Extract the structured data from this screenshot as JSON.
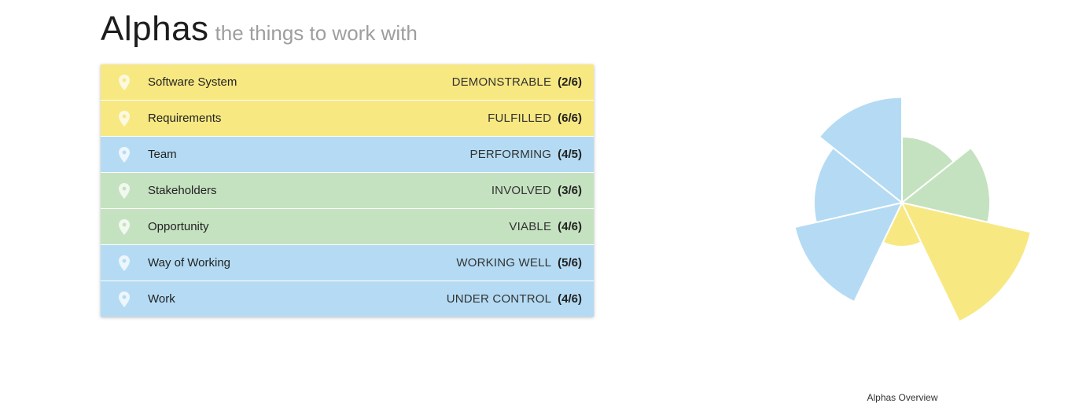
{
  "header": {
    "title": "Alphas",
    "subtitle": "the things to work with"
  },
  "colors": {
    "yellow": "#f7e882",
    "blue": "#b4dbf3",
    "green": "#c5e2c0"
  },
  "alphas": [
    {
      "name": "Software System",
      "state": "DEMONSTRABLE",
      "progress": "(2/6)",
      "color": "yellow",
      "icon": "location-pin-icon"
    },
    {
      "name": "Requirements",
      "state": "FULFILLED",
      "progress": "(6/6)",
      "color": "yellow",
      "icon": "location-pin-icon"
    },
    {
      "name": "Team",
      "state": "PERFORMING",
      "progress": "(4/5)",
      "color": "blue",
      "icon": "location-pin-icon"
    },
    {
      "name": "Stakeholders",
      "state": "INVOLVED",
      "progress": "(3/6)",
      "color": "green",
      "icon": "location-pin-icon"
    },
    {
      "name": "Opportunity",
      "state": "VIABLE",
      "progress": "(4/6)",
      "color": "green",
      "icon": "location-pin-icon"
    },
    {
      "name": "Way of Working",
      "state": "WORKING WELL",
      "progress": "(5/6)",
      "color": "blue",
      "icon": "location-pin-icon"
    },
    {
      "name": "Work",
      "state": "UNDER CONTROL",
      "progress": "(4/6)",
      "color": "blue",
      "icon": "location-pin-icon"
    }
  ],
  "chart": {
    "caption": "Alphas Overview"
  },
  "chart_data": {
    "type": "pie",
    "variant": "polar-area",
    "title": "Alphas Overview",
    "categories": [
      "Stakeholders",
      "Opportunity",
      "Requirements",
      "Software System",
      "Way of Working",
      "Work",
      "Team"
    ],
    "values": [
      0.5,
      0.667,
      1.0,
      0.333,
      0.833,
      0.667,
      0.8
    ],
    "colors": [
      "green",
      "green",
      "yellow",
      "yellow",
      "blue",
      "blue",
      "blue"
    ],
    "start_angle_deg": 0,
    "direction": "clockwise"
  }
}
